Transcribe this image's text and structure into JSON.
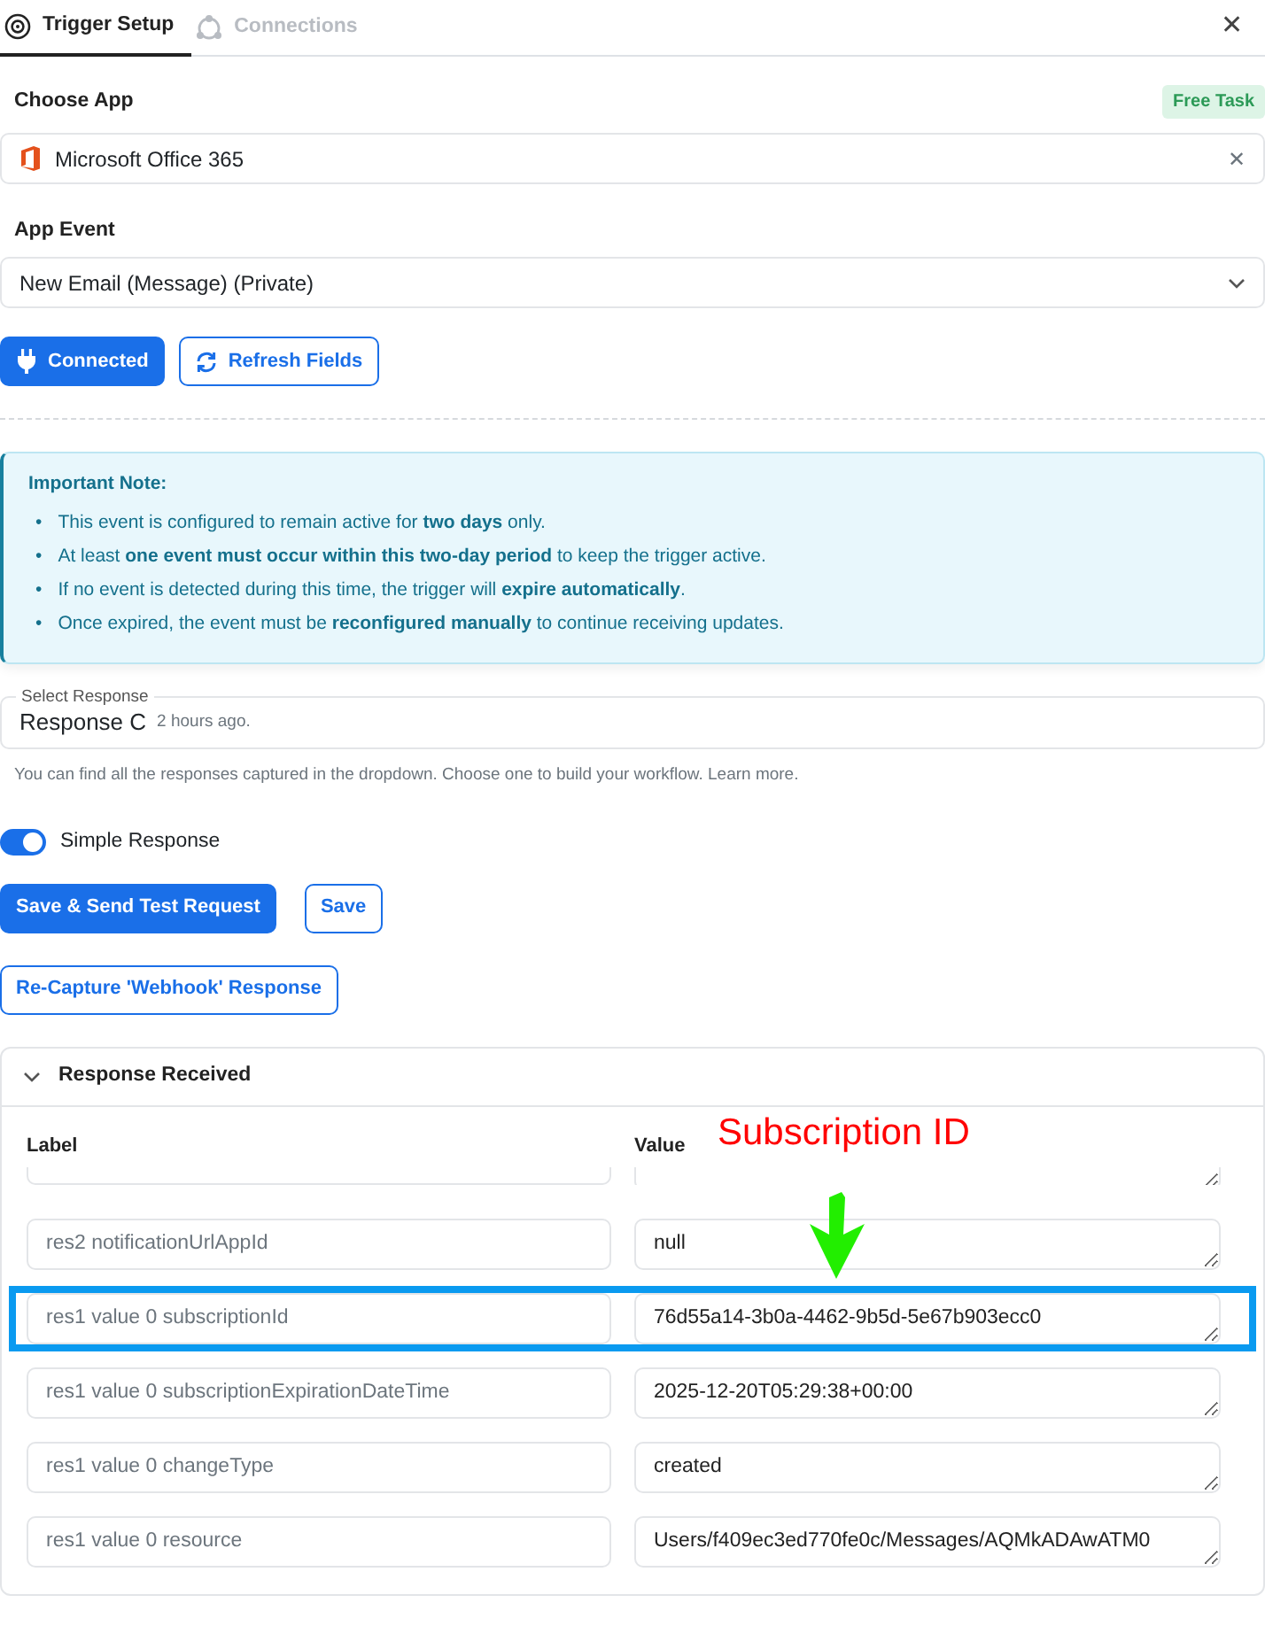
{
  "tabs": [
    {
      "label": "Trigger Setup",
      "selected": true,
      "kind": "trigger"
    },
    {
      "label": "Connections",
      "selected": false,
      "kind": "connections"
    }
  ],
  "close": "✕",
  "choose_app": {
    "label": "Choose App",
    "badge": "Free Task",
    "value": "Microsoft Office 365",
    "clear": "✕"
  },
  "app_event": {
    "label": "App Event",
    "value": "New Email (Message) (Private)"
  },
  "connect_buttons": [
    {
      "label": "Connected",
      "kind": "primary"
    },
    {
      "label": "Refresh Fields",
      "kind": "outline"
    }
  ],
  "note": {
    "title": "Important Note:",
    "items": [
      {
        "bullet": "•",
        "text": "This event is configured to remain active for **two days** only."
      },
      {
        "bullet": "•",
        "text": "At least **one event must occur within this two-day period** to keep the trigger active."
      },
      {
        "bullet": "•",
        "text": "If no event is detected during this time, the trigger will **expire automatically**."
      },
      {
        "bullet": "•",
        "text": "Once expired, the event must be **reconfigured manually** to continue receiving updates."
      }
    ]
  },
  "select_response": {
    "label": "Select Response",
    "value": "Response C",
    "time": "2 hours ago.",
    "help": "You can find all the responses captured in the dropdown. Choose one to build your workflow. Learn more."
  },
  "simple_response": {
    "label": "Simple Response",
    "on": true
  },
  "action_buttons": [
    {
      "label": "Save & Send Test Request",
      "kind": "primary"
    },
    {
      "label": "Save",
      "kind": "outline"
    }
  ],
  "recapture_button": {
    "label": "Re-Capture 'Webhook' Response"
  },
  "response_received": {
    "title": "Response Received",
    "expanded": true,
    "columns": [
      "Label",
      "Value"
    ],
    "rows": [
      {
        "kind": "clipped",
        "highlighted": false
      },
      {
        "kind": "text",
        "label": "res2 notificationUrlAppId",
        "value": "null",
        "highlighted": false
      },
      {
        "kind": "text",
        "label": "res1 value 0 subscriptionId",
        "value": "76d55a14-3b0a-4462-9b5d-5e67b903ecc0",
        "highlighted": true
      },
      {
        "kind": "text",
        "label": "res1 value 0 subscriptionExpirationDateTime",
        "value": "2025-12-20T05:29:38+00:00",
        "highlighted": false
      },
      {
        "kind": "text",
        "label": "res1 value 0 changeType",
        "value": "created",
        "highlighted": false
      },
      {
        "kind": "scroll",
        "label": "res1 value 0 resource",
        "value": "Users/f409ec3ed770fe0c/Messages/AQMkADAwATM0",
        "highlighted": false
      }
    ]
  },
  "annotation": {
    "label": "Subscription ID"
  }
}
